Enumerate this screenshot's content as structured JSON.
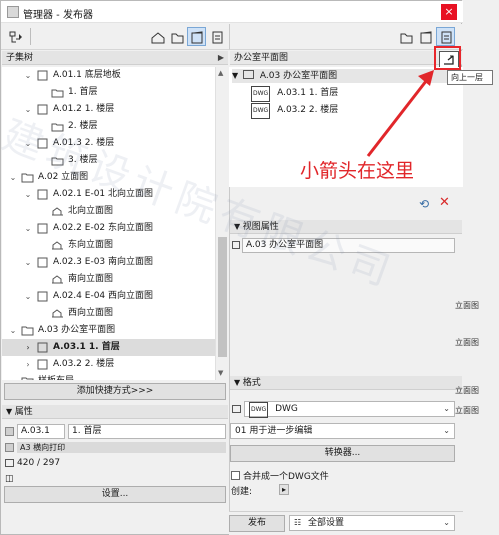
{
  "window": {
    "title": "管理器 - 发布器",
    "close_label": "×"
  },
  "left_panel": {
    "section_title": "子集树",
    "tree": [
      {
        "label": "A.01.1 底层地板",
        "level": 1,
        "type": "subset",
        "expanded": true
      },
      {
        "label": "1. 首层",
        "level": 2,
        "type": "view"
      },
      {
        "label": "A.01.2 1. 楼层",
        "level": 1,
        "type": "subset",
        "expanded": true
      },
      {
        "label": "2. 楼层",
        "level": 2,
        "type": "view"
      },
      {
        "label": "A.01.3 2. 楼层",
        "level": 1,
        "type": "subset",
        "expanded": true
      },
      {
        "label": "3. 楼层",
        "level": 2,
        "type": "view"
      },
      {
        "label": "A.02 立面图",
        "level": 0,
        "type": "folder",
        "expanded": true
      },
      {
        "label": "A.02.1 E-01 北向立面图",
        "level": 1,
        "type": "subset",
        "expanded": true
      },
      {
        "label": "北向立面图",
        "level": 2,
        "type": "elev"
      },
      {
        "label": "A.02.2 E-02 东向立面图",
        "level": 1,
        "type": "subset",
        "expanded": true
      },
      {
        "label": "东向立面图",
        "level": 2,
        "type": "elev"
      },
      {
        "label": "A.02.3 E-03 南向立面图",
        "level": 1,
        "type": "subset",
        "expanded": true
      },
      {
        "label": "南向立面图",
        "level": 2,
        "type": "elev"
      },
      {
        "label": "A.02.4 E-04 西向立面图",
        "level": 1,
        "type": "subset",
        "expanded": true
      },
      {
        "label": "西向立面图",
        "level": 2,
        "type": "elev"
      },
      {
        "label": "A.03 办公室平面图",
        "level": 0,
        "type": "folder",
        "expanded": true
      },
      {
        "label": "A.03.1 1. 首层",
        "level": 1,
        "type": "subset",
        "expanded": false,
        "selected": true
      },
      {
        "label": "A.03.2 2. 楼层",
        "level": 1,
        "type": "subset",
        "expanded": false
      },
      {
        "label": "样板布局",
        "level": 0,
        "type": "folder",
        "expanded": false
      }
    ],
    "add_shortcut_button": "添加快捷方式>>>",
    "properties_title": "属性",
    "prop_id": "A.03.1",
    "prop_name": "1. 首层",
    "prop_layout": "A3 横向打印",
    "prop_size": "420 / 297",
    "settings_button": "设置..."
  },
  "right_panel": {
    "section_title": "办公室平面图",
    "tree_root": "A.03 办公室平面图",
    "items": [
      {
        "label": "A.03.1 1. 首层"
      },
      {
        "label": "A.03.2 2. 楼层"
      }
    ],
    "tooltip": "向上一层",
    "view_props_title": "视图属性",
    "view_props_value": "A.03 办公室平面图",
    "format_title": "格式",
    "format_value": "DWG",
    "format_option": "01 用于进一步编辑",
    "converter_button": "转换器...",
    "merge_label": "合并成一个DWG文件",
    "create_label": "创建:",
    "publish_button": "发布",
    "publish_set": "全部设置",
    "behind_text_1": "立面图",
    "behind_text_2": "立面图",
    "behind_text_3": "立面图",
    "behind_text_4": "立面图"
  },
  "annotation": {
    "callout_text": "小箭头在这里",
    "color": "#e1262a"
  },
  "watermark": "建筑设计院有限公司"
}
